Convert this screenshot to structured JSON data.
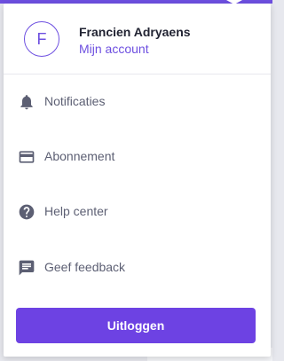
{
  "profile": {
    "avatar_initial": "F",
    "name": "Francien Adryaens",
    "account_link": "Mijn account"
  },
  "menu": {
    "items": [
      {
        "label": "Notificaties",
        "icon": "bell-icon"
      },
      {
        "label": "Abonnement",
        "icon": "credit-card-icon"
      },
      {
        "label": "Help center",
        "icon": "help-circle-icon"
      },
      {
        "label": "Geef feedback",
        "icon": "feedback-icon"
      }
    ]
  },
  "logout_label": "Uitloggen",
  "colors": {
    "accent": "#6d4fe0",
    "button": "#6d42e3",
    "icon": "#5c5f73",
    "text": "#222433"
  }
}
